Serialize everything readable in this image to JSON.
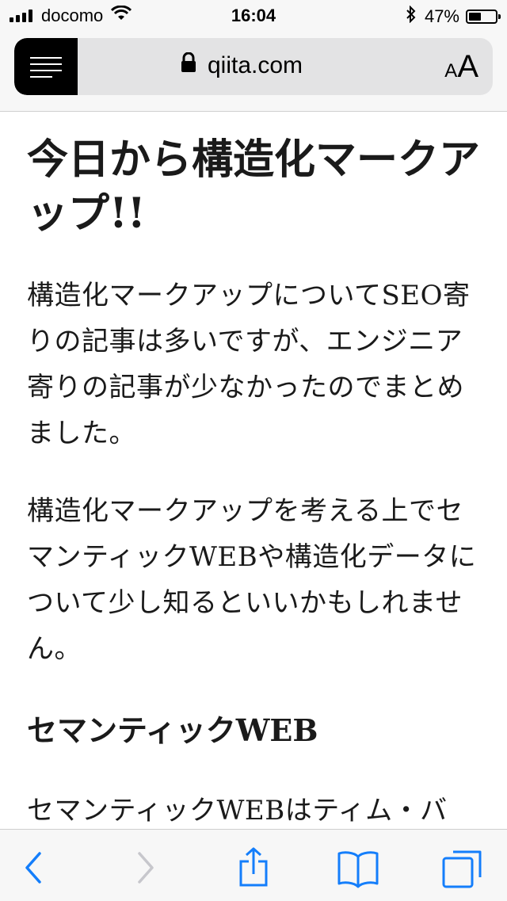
{
  "status_bar": {
    "carrier": "docomo",
    "time": "16:04",
    "battery_percent": "47%",
    "battery_level": 0.47
  },
  "browser": {
    "url": "qiita.com",
    "text_size_button": {
      "small": "A",
      "large": "A"
    }
  },
  "article": {
    "title": "今日から構造化マークアップ!!",
    "paragraph1": "構造化マークアップについてSEO寄りの記事は多いですが、エンジニア寄りの記事が少なかったのでまとめました。",
    "paragraph2": "構造化マークアップを考える上でセマンティックWEBや構造化データについて少し知るといいかもしれません。",
    "section_heading": "セマンティックWEB",
    "paragraph3": "セマンティックWEBはティム・バ"
  },
  "colors": {
    "accent": "#147efb",
    "disabled": "#c7c7cc"
  }
}
